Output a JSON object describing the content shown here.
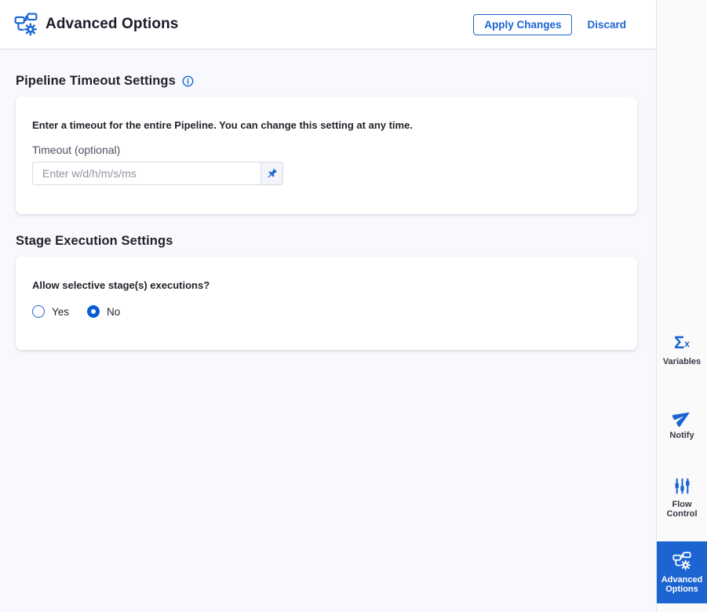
{
  "header": {
    "title": "Advanced Options",
    "apply_label": "Apply Changes",
    "discard_label": "Discard"
  },
  "sections": {
    "timeout": {
      "heading": "Pipeline Timeout Settings",
      "description": "Enter a timeout for the entire Pipeline. You can change this setting at any time.",
      "field_label": "Timeout (optional)",
      "input_value": "",
      "placeholder": "Enter w/d/h/m/s/ms"
    },
    "stage_execution": {
      "heading": "Stage Execution Settings",
      "question": "Allow selective stage(s) executions?",
      "options": [
        {
          "label": "Yes",
          "selected": false
        },
        {
          "label": "No",
          "selected": true
        }
      ]
    }
  },
  "sidebar": {
    "items": [
      {
        "label": "Variables",
        "icon": "sigma-x-icon",
        "active": false
      },
      {
        "label": "Notify",
        "icon": "paper-plane-icon",
        "active": false
      },
      {
        "label": "Flow Control",
        "icon": "sliders-icon",
        "active": false
      },
      {
        "label": "Advanced Options",
        "icon": "pipeline-gear-icon",
        "active": true
      }
    ]
  },
  "icons": {
    "sigma_glyph": "Σ",
    "sigma_sup": "x"
  },
  "colors": {
    "primary_blue": "#1b64d2",
    "radio_selected_blue": "#0b5cd7",
    "active_tab_bg": "#1b64d2",
    "text_dark": "#22222a",
    "label_gray": "#4f5162",
    "placeholder_gray": "#9293a0",
    "content_bg": "#f8f9fe",
    "sidebar_bg": "#fafafa"
  }
}
